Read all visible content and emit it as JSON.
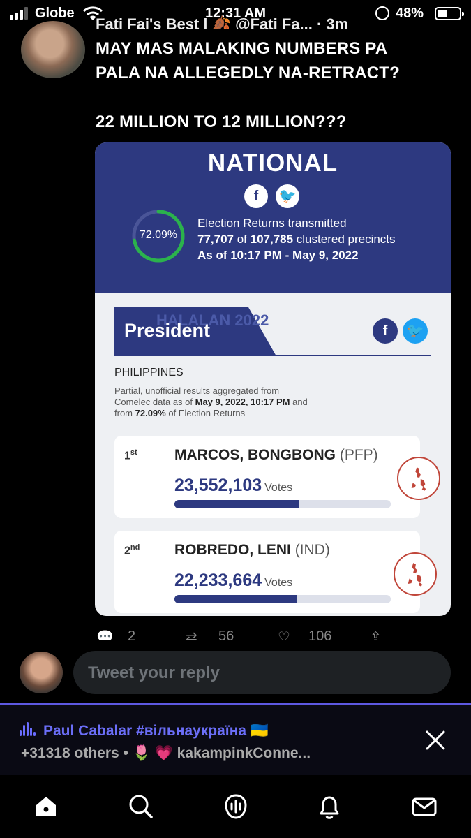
{
  "status_bar": {
    "carrier": "Globe",
    "time": "12:31 AM",
    "battery": "48%",
    "battery_level": 0.48
  },
  "tweet": {
    "header": "Fati Fai's Best | 🍂 @Fati Fa... · 3m",
    "lines": [
      "MAY MAS MALAKING NUMBERS PA",
      "PALA NA ALLEGEDLY NA-RETRACT?",
      "22 MILLION TO 12 MILLION???"
    ]
  },
  "card": {
    "region_title": "NATIONAL",
    "percent_label": "72.09%",
    "percent_value": 0.7209,
    "er_line1": "Election Returns transmitted",
    "er_count": "77,707",
    "er_of": " of ",
    "er_total": "107,785",
    "er_suffix": " clustered precincts",
    "er_asof": "As of 10:17 PM - May 9, 2022",
    "section_title": "President",
    "watermark": "HALALAN 2022",
    "country": "PHILIPPINES",
    "note_1": "Partial, unofficial results aggregated from",
    "note_2a": "Comelec data as of ",
    "note_2b": "May 9, 2022, 10:17 PM",
    "note_2c": " and",
    "note_3a": "from ",
    "note_3b": "72.09%",
    "note_3c": " of Election Returns",
    "candidates": [
      {
        "rank": "1",
        "rank_suffix": "st",
        "name": "MARCOS, BONGBONG",
        "party": "(PFP)",
        "votes": "23,552,103",
        "votes_label": "Votes",
        "share": 0.575
      },
      {
        "rank": "2",
        "rank_suffix": "nd",
        "name": "ROBREDO, LENI",
        "party": "(IND)",
        "votes": "22,233,664",
        "votes_label": "Votes",
        "share": 0.567
      }
    ]
  },
  "actions": {
    "replies": "2",
    "retweets": "56",
    "likes": "106"
  },
  "reply": {
    "placeholder": "Tweet your reply"
  },
  "spaces": {
    "host": "Paul Cabalar #вільнаукраїна 🇺🇦",
    "listeners": "+31318 others • 🌷 💗 kakampinkConne..."
  },
  "colors": {
    "card_blue": "#2d3980",
    "spaces_accent": "#6b6ef7",
    "progress_green": "#2bb24c"
  }
}
